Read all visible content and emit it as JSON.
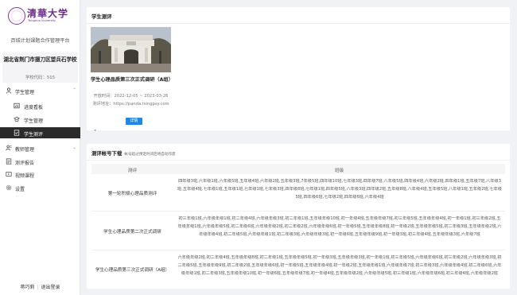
{
  "sidebar": {
    "logo": {
      "text": "清華大学",
      "sub": "Tsinghua University"
    },
    "platform_title": "百城计划课题合作管理平台",
    "school_name": "湖北省荆门市掇刀区望兵石学校",
    "school_code": "学校代码：515",
    "menu": [
      {
        "label": "学生管理",
        "icon": "user-icon",
        "group": true,
        "expanded": true
      },
      {
        "label": "进度看板",
        "icon": "dashboard-icon",
        "group": false
      },
      {
        "label": "学生管理",
        "icon": "student-icon",
        "group": false
      },
      {
        "label": "学生测评",
        "icon": "checklist-icon",
        "group": false,
        "active": true
      },
      {
        "label": "教师管理",
        "icon": "teacher-icon",
        "group": true,
        "expanded": false
      },
      {
        "label": "测评报告",
        "icon": "report-icon",
        "group": false
      },
      {
        "label": "视频课程",
        "icon": "video-icon",
        "group": false
      },
      {
        "label": "设置",
        "icon": "gear-icon",
        "group": false
      }
    ],
    "footer": {
      "user": "蒋巧莉",
      "logout": "退出登录"
    }
  },
  "assessment_panel": {
    "title": "学生测评",
    "card": {
      "title": "学生心理品质第三次正式调研（A组）",
      "time": "开放时间：2022-12-05 ~ 2023-03-26",
      "address": "测评地址：https://panda.tsingpsy.com",
      "button": "详情"
    }
  },
  "accounts_panel": {
    "title": "测评帐号下载",
    "note": "帐号超过预定时间后将自动作废",
    "columns": [
      "测评",
      "班级"
    ],
    "rows": [
      {
        "name": "第一轮积极心理品质测评",
        "classes": "四年级3班,六年级1班,六年级5班,五年级4班,六年级2班,五年级3班,7年级5班,四年级10班,七年级3班,四年级7班,八年级5班,四年级4班,六年级2班,四年级1班,五年级7班,八年级3班,五年级4班,七年级1班,五年级1班,七年级1班,七年级3班,四年级8班,七年级1班,四年级5班,八年级3班,四年级2班,五年级8班,八年级4班,五年级5班,八年级1班,五年级2班,七年级5班,四年级6班,七年级2班,四年级6班,六年级4班"
      },
      {
        "name": "学生心理品质第二次正式调研",
        "classes": "初三年级1班,六年级年级1班,初二年级4班,六年级年级3班,初二年级1班,五年级年级10班,初一年级4班,五年级年级7班,初三年级5班,五年级年级4班,初一年级1班,初三年级2班,五年级年级1班,六年级年级5班,初二年级6班,六年级年级2班,初二年级2班,六年级年级6班,初一年级5班,五年级年级8班,初一年级2班,五年级年级5班,初二年级3班,五年级年级2班,六年级年级4班,初二年级5班,六年级年级1班,初二年级3班,六年级年级3班,初一年级6班,五年级年级9班,初一年级3班,初三年级4班,五年级年级3班,六年级7班"
      },
      {
        "name": "学生心理品质第三次正式调研（A组）",
        "classes": "六年级年级2班,初二年级4班,五年级年级8班,初二年级1班,五年级年级5班,初一年级3班,五年级年级3班,初一年级1班,初三年级5班,六年级年级6班,初三年级2班,六年级年级3班,初二年级5班,五年级年级9班,初二年级2班,五年级年级6班,初一年级5班,五年级年级4班,初一年级2班,五年级年级1班,六年级年级7班,初三年级3班,六年级年级4班,初二年级6班,六年级年级1班,初二年级3班,五年级年级10班,初一年级6班,五年级年级7班,初一年级4班,五年级年级2班,六年级年级5班,初三年级1班,六年级年级6班,初三年级4班,六年级年级2班"
      }
    ]
  }
}
